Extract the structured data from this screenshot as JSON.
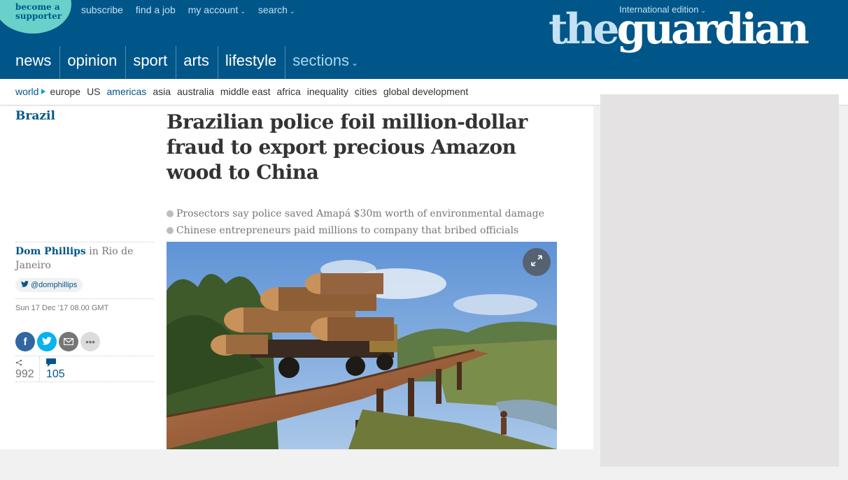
{
  "header": {
    "supporter_label": [
      "become a",
      "supporter"
    ],
    "top_links": [
      {
        "label": "subscribe",
        "dropdown": false
      },
      {
        "label": "find a job",
        "dropdown": false
      },
      {
        "label": "my account",
        "dropdown": true
      },
      {
        "label": "search",
        "dropdown": true
      }
    ],
    "edition": "International edition",
    "logo": {
      "the": "the",
      "guardian": "guardian"
    },
    "pillars": [
      "news",
      "opinion",
      "sport",
      "arts",
      "lifestyle"
    ],
    "sections_label": "sections"
  },
  "subnav": {
    "parent": "world",
    "items": [
      "europe",
      "US",
      "americas",
      "asia",
      "australia",
      "middle east",
      "africa",
      "inequality",
      "cities",
      "global development"
    ],
    "active": "americas"
  },
  "article": {
    "section": "Brazil",
    "headline": "Brazilian police foil million-dollar fraud to export precious Amazon wood to China",
    "standfirst": [
      "Prosectors say police saved Amapá $30m worth of environmental damage",
      "Chinese entrepreneurs paid millions to company that bribed officials"
    ],
    "author": "Dom Phillips",
    "location": "in Rio de Janeiro",
    "twitter_handle": "@domphillips",
    "date": "Sun 17 Dec ’17 08.00 GMT",
    "share_count": "992",
    "comment_count": "105"
  },
  "colors": {
    "header_blue": "#005689",
    "supporter_teal": "#69d1ca",
    "facebook": "#3067a3",
    "twitter": "#03b3ee"
  },
  "icons": {
    "share_buttons": [
      "facebook-icon",
      "twitter-icon",
      "email-icon",
      "more-icon"
    ],
    "expand": "expand-icon"
  }
}
